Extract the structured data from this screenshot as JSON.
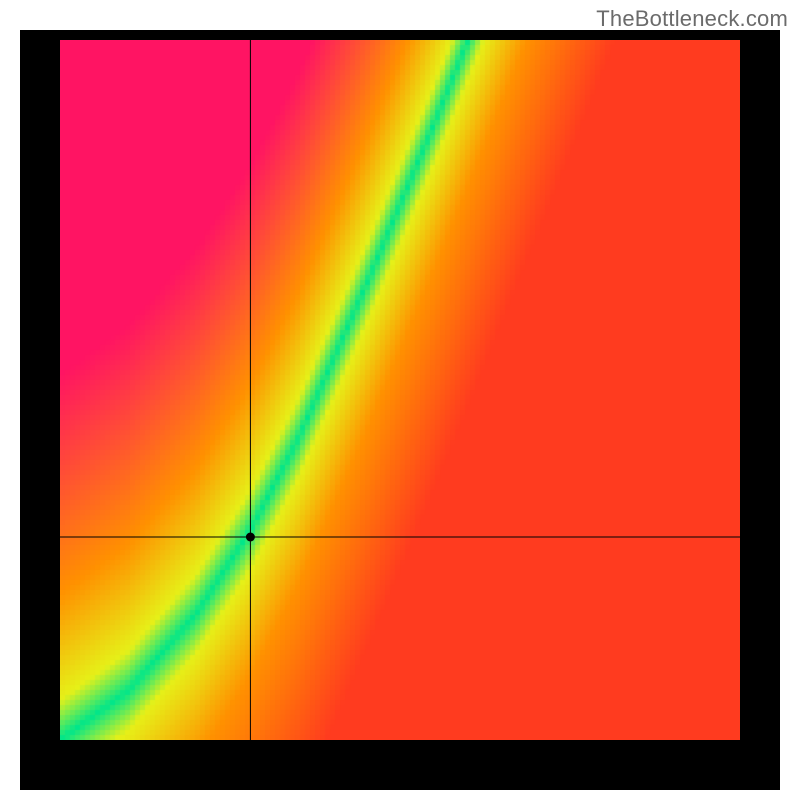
{
  "watermark": "TheBottleneck.com",
  "chart_data": {
    "type": "heatmap",
    "title": "",
    "xlabel": "",
    "ylabel": "",
    "xlim": [
      0,
      100
    ],
    "ylim": [
      0,
      100
    ],
    "crosshair": {
      "x": 28,
      "y": 29
    },
    "ideal_curve": [
      {
        "x": 0,
        "y": 0
      },
      {
        "x": 10,
        "y": 7
      },
      {
        "x": 20,
        "y": 18
      },
      {
        "x": 28,
        "y": 30
      },
      {
        "x": 35,
        "y": 43
      },
      {
        "x": 45,
        "y": 65
      },
      {
        "x": 55,
        "y": 88
      },
      {
        "x": 60,
        "y": 100
      }
    ],
    "field_description": "distance-to-ideal heatmap: green on the ideal curve fading through yellow/orange to red with distance; warm orange dominates the lower-right half, pink-red dominates the upper-left",
    "colors": {
      "ideal": "#00e68a",
      "near": "#e6f018",
      "mid": "#ff9100",
      "far_warm": "#ff3b1f",
      "far_cool": "#ff1463"
    },
    "marker": {
      "x": 28,
      "y": 29,
      "label": ""
    }
  }
}
